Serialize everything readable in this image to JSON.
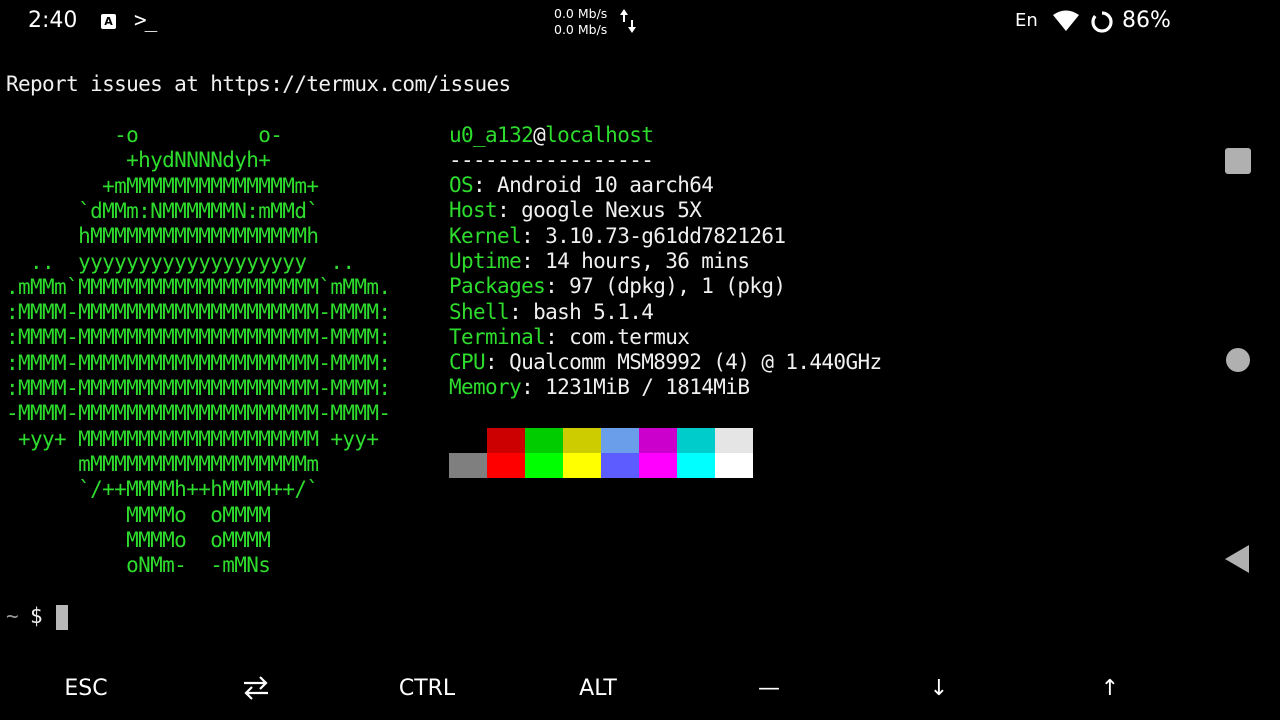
{
  "status_bar": {
    "time": "2:40",
    "notification_icons": [
      "a-icon",
      "terminal-icon"
    ],
    "net_up": "0.0 Mb/s",
    "net_down": "0.0 Mb/s",
    "language": "En",
    "battery": "86%"
  },
  "terminal": {
    "report_line": "Report issues at https://termux.com/issues",
    "ascii_logo": [
      "         -o          o-",
      "          +hydNNNNdyh+",
      "        +mMMMMMMMMMMMMMMm+",
      "      `dMMm:NMMMMMMN:mMMd`",
      "      hMMMMMMMMMMMMMMMMMMh",
      "  ..  yyyyyyyyyyyyyyyyyyy  ..",
      ".mMMm`MMMMMMMMMMMMMMMMMMMM`mMMm.",
      ":MMMM-MMMMMMMMMMMMMMMMMMMM-MMMM:",
      ":MMMM-MMMMMMMMMMMMMMMMMMMM-MMMM:",
      ":MMMM-MMMMMMMMMMMMMMMMMMMM-MMMM:",
      ":MMMM-MMMMMMMMMMMMMMMMMMMM-MMMM:",
      "-MMMM-MMMMMMMMMMMMMMMMMMMM-MMMM-",
      " +yy+ MMMMMMMMMMMMMMMMMMMM +yy+",
      "      mMMMMMMMMMMMMMMMMMMm",
      "      `/++MMMMh++hMMMM++/`",
      "          MMMMo  oMMMM",
      "          MMMMo  oMMMM",
      "          oNMm-  -mMNs"
    ],
    "user": "u0_a132",
    "at": "@",
    "host": "localhost",
    "separator": "-----------------",
    "info": [
      {
        "key": "OS",
        "value": ": Android 10 aarch64"
      },
      {
        "key": "Host",
        "value": ": google Nexus 5X"
      },
      {
        "key": "Kernel",
        "value": ": 3.10.73-g61dd7821261"
      },
      {
        "key": "Uptime",
        "value": ": 14 hours, 36 mins"
      },
      {
        "key": "Packages",
        "value": ": 97 (dpkg), 1 (pkg)"
      },
      {
        "key": "Shell",
        "value": ": bash 5.1.4"
      },
      {
        "key": "Terminal",
        "value": ": com.termux"
      },
      {
        "key": "CPU",
        "value": ": Qualcomm MSM8992 (4) @ 1.440GHz"
      },
      {
        "key": "Memory",
        "value": ": 1231MiB / 1814MiB"
      }
    ],
    "palette_row1": [
      "#000000",
      "#cc0000",
      "#00cc00",
      "#cccc00",
      "#6b9eea",
      "#cc00cc",
      "#00cccc",
      "#e5e5e5"
    ],
    "palette_row2": [
      "#7f7f7f",
      "#ff0000",
      "#00ff00",
      "#ffff00",
      "#5c5cff",
      "#ff00ff",
      "#00ffff",
      "#ffffff"
    ],
    "prompt_tilde": "~",
    "prompt_dollar": "$"
  },
  "extra_keys": {
    "esc": "ESC",
    "tab_icon": "tab-arrows-icon",
    "ctrl": "CTRL",
    "alt": "ALT",
    "dash": "—",
    "down": "↓",
    "up": "↑"
  }
}
